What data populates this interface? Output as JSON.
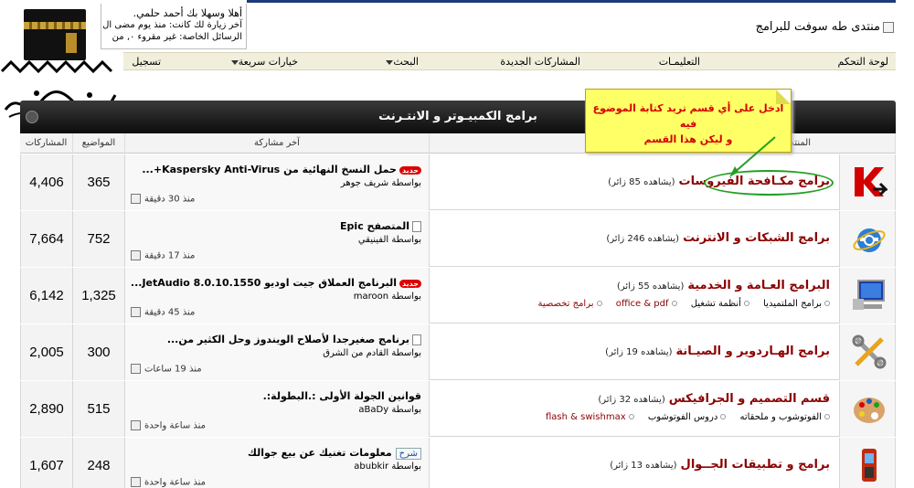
{
  "header": {
    "forum_title": "منتدى طه سوفت للبرامج",
    "welcome_line1": "أهلا وسهلا بك أحمد حلمي.",
    "welcome_line2": "آخر زيارة لك كانت: منذ يوم مضى ال",
    "welcome_line3": "الرسائل الخاصة: غير مقروء ٠, من"
  },
  "navbar": {
    "items": [
      {
        "label": "لوحة التحكم"
      },
      {
        "label": "التعليمـات"
      },
      {
        "label": "المشاركات الجديدة"
      },
      {
        "label": "البحث"
      },
      {
        "label": "خيارات سريعة"
      },
      {
        "label": "تسجيل"
      }
    ]
  },
  "category": {
    "title": "برامج الكمبيـوتر و الانتـرنت"
  },
  "columns": {
    "forum": "المنتدى",
    "last_post": "آخر مشاركة",
    "threads": "المواضيع",
    "posts": "المشاركات"
  },
  "callout": {
    "line1": "ادخل على أي قسم تريد كتابة الموضوع فيه",
    "line2": "و ليكن هذا القسم"
  },
  "forums": [
    {
      "icon": "kaspersky-icon",
      "name": "برامج مكـافحة الفيروسات",
      "viewers": "(يشاهده 85 زائر)",
      "subforums": [],
      "last_title": "حمل النسخ النهائية من Kaspersky Anti-Virus+...",
      "last_badge": "جديد",
      "last_by": "بواسطة شريف جوهر",
      "last_time": "منذ 30 دقيقة",
      "threads": "365",
      "posts": "4,406"
    },
    {
      "icon": "internet-explorer-icon",
      "name": "برامج الشبكات و الانترنت",
      "viewers": "(يشاهده 246 زائر)",
      "subforums": [],
      "last_title": "المتصفح Epic",
      "last_badge": "",
      "last_by": "بواسطة الفينيقي",
      "last_time": "منذ 17 دقيقة",
      "threads": "752",
      "posts": "7,664"
    },
    {
      "icon": "computer-monitor-icon",
      "name": "البرامج العـامة و الخدمية",
      "viewers": "(يشاهده 55 زائر)",
      "subforums": [
        "برامج تخصصية",
        "office & pdf",
        "أنظمة تشغيل",
        "برامج الملتميديا"
      ],
      "last_title": "البرنامج العملاق جيت اوديو JetAudio 8.0.10.1550...",
      "last_badge": "جديد",
      "last_by": "بواسطة maroon",
      "last_time": "منذ 45 دقيقة",
      "threads": "1,325",
      "posts": "6,142"
    },
    {
      "icon": "tools-icon",
      "name": "برامج الهـاردوير و الصيـانة",
      "viewers": "(يشاهده 19 زائر)",
      "subforums": [],
      "last_title": "برنامج صغيرجدا لأصلاح الويندوز وحل الكثير من...",
      "last_badge": "",
      "last_by": "بواسطة القادم من الشرق",
      "last_time": "منذ 19 ساعات",
      "threads": "300",
      "posts": "2,005"
    },
    {
      "icon": "paint-palette-icon",
      "name": "قسم التصميم و الجرافيكس",
      "viewers": "(يشاهده 32 زائر)",
      "subforums": [
        "flash & swishmax",
        "دروس الفوتوشوب",
        "الفوتوشوب و ملحقاته"
      ],
      "last_title": "قوانين الجولة الأولى :.البطولة:.",
      "last_badge": "",
      "last_by": "بواسطة aBaDy",
      "last_time": "منذ ساعة واحدة",
      "threads": "515",
      "posts": "2,890"
    },
    {
      "icon": "mobile-phone-icon",
      "name": "برامج و تطبيقات الجــوال",
      "viewers": "(يشاهده 13 زائر)",
      "subforums": [],
      "last_title": "معلومات تغنيك عن بيع جوالك",
      "last_badge": "شرح",
      "last_by": "بواسطة abubkir",
      "last_time": "منذ ساعة واحدة",
      "threads": "248",
      "posts": "1,607"
    }
  ]
}
